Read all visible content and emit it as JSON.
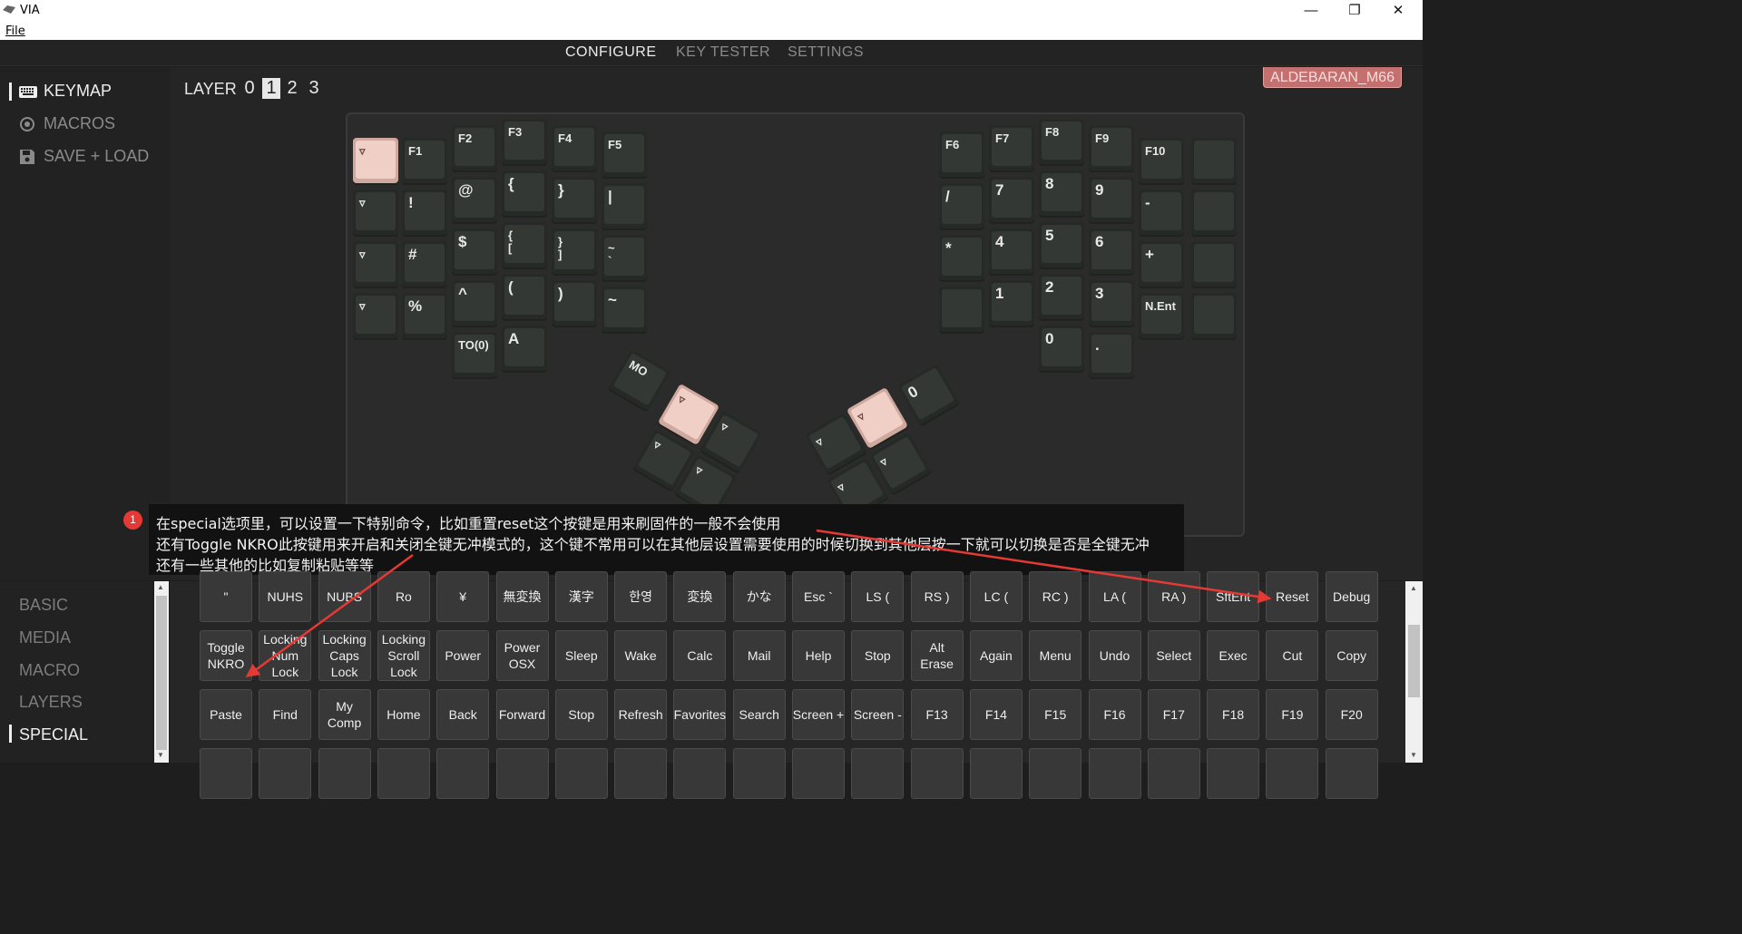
{
  "window": {
    "title": "VIA",
    "menu_file": "File",
    "btn_min": "—",
    "btn_max": "❐",
    "btn_close": "✕"
  },
  "topnav": {
    "tabs": [
      "CONFIGURE",
      "KEY TESTER",
      "SETTINGS"
    ],
    "active": "CONFIGURE"
  },
  "sidebar_top": {
    "items": [
      {
        "label": "KEYMAP",
        "icon": "keyboard-icon",
        "active": true
      },
      {
        "label": "MACROS",
        "icon": "target-icon",
        "active": false
      },
      {
        "label": "SAVE + LOAD",
        "icon": "floppy-disk-icon",
        "active": false
      }
    ]
  },
  "layer": {
    "label": "LAYER",
    "options": [
      "0",
      "1",
      "2",
      "3"
    ],
    "selected": "1"
  },
  "device": {
    "name": "ALDEBARAN_M66"
  },
  "keyboard": {
    "keys": [
      "▿",
      "F1",
      "F2",
      "F3",
      "F4",
      "F5",
      "▿",
      "!",
      "@",
      "{",
      "}",
      "|",
      "▿",
      "#",
      "$",
      "{\n[",
      "}\n]",
      "~\n`",
      "▿",
      "%",
      "^",
      "(",
      ")",
      "~",
      "TO(0)",
      "A",
      "F6",
      "F7",
      "F8",
      "F9",
      "F10",
      "",
      "/",
      "7",
      "8",
      "9",
      "-",
      "",
      "*",
      "4",
      "5",
      "6",
      "+",
      "",
      "",
      "1",
      "2",
      "3",
      "N.Ent",
      "",
      "0",
      ".",
      "MO",
      "▿",
      "▿",
      "▿",
      "▿",
      "0",
      "▿",
      "▿",
      "▿",
      "▿"
    ]
  },
  "annotation": {
    "number": "1",
    "lines": [
      "在special选项里，可以设置一下特别命令，比如重置reset这个按键是用来刷固件的一般不会使用",
      "还有Toggle NKRO此按键用来开启和关闭全键无冲模式的，这个键不常用可以在其他层设置需要使用的时候切换到其他层按一下就可以切换是否是全键无冲",
      "还有一些其他的比如复制粘贴等等"
    ]
  },
  "sidebar_bottom": {
    "items": [
      "BASIC",
      "MEDIA",
      "MACRO",
      "LAYERS",
      "SPECIAL"
    ],
    "active": "SPECIAL"
  },
  "special_keys": {
    "rows": [
      [
        "\"",
        "NUHS",
        "NUBS",
        "Ro",
        "¥",
        "無変換",
        "漢字",
        "한영",
        "変換",
        "かな",
        "Esc `",
        "LS (",
        "RS )",
        "LC (",
        "RC )",
        "LA (",
        "RA )",
        "SftEnt",
        "Reset",
        "Debug"
      ],
      [
        "Toggle\nNKRO",
        "Locking\nNum\nLock",
        "Locking\nCaps\nLock",
        "Locking\nScroll\nLock",
        "Power",
        "Power\nOSX",
        "Sleep",
        "Wake",
        "Calc",
        "Mail",
        "Help",
        "Stop",
        "Alt\nErase",
        "Again",
        "Menu",
        "Undo",
        "Select",
        "Exec",
        "Cut",
        "Copy"
      ],
      [
        "Paste",
        "Find",
        "My\nComp",
        "Home",
        "Back",
        "Forward",
        "Stop",
        "Refresh",
        "Favorites",
        "Search",
        "Screen +",
        "Screen -",
        "F13",
        "F14",
        "F15",
        "F16",
        "F17",
        "F18",
        "F19",
        "F20"
      ]
    ]
  },
  "colors": {
    "accent": "#c4706f",
    "selected_key": "#f0cfc6",
    "arrow": "#e53935"
  }
}
